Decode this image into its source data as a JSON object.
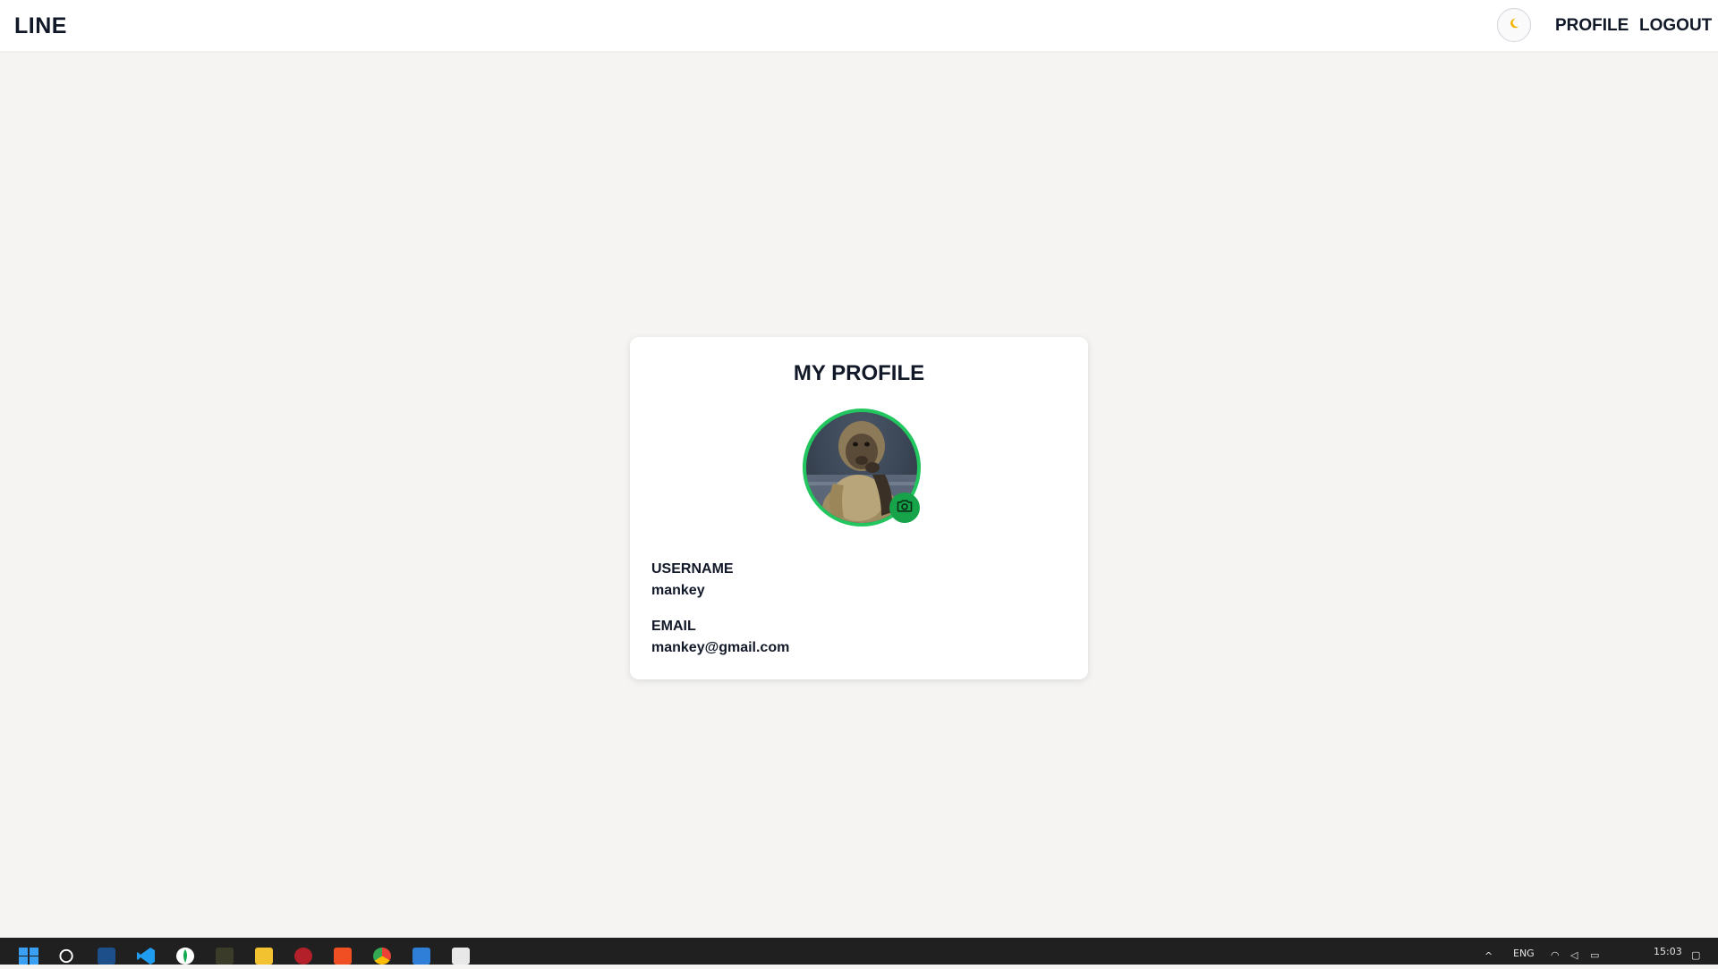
{
  "navbar": {
    "brand": "LINE",
    "theme_toggle_icon": "moon-icon",
    "links": {
      "profile": "PROFILE",
      "logout": "LOGOUT"
    }
  },
  "profile_card": {
    "title": "MY PROFILE",
    "avatar_icon": "avatar",
    "upload_icon": "camera-icon",
    "accent_color": "#22c55e",
    "fields": [
      {
        "label": "USERNAME",
        "value": "mankey"
      },
      {
        "label": "EMAIL",
        "value": "mankey@gmail.com"
      }
    ]
  },
  "taskbar": {
    "language": "ENG",
    "time": "15:03"
  }
}
